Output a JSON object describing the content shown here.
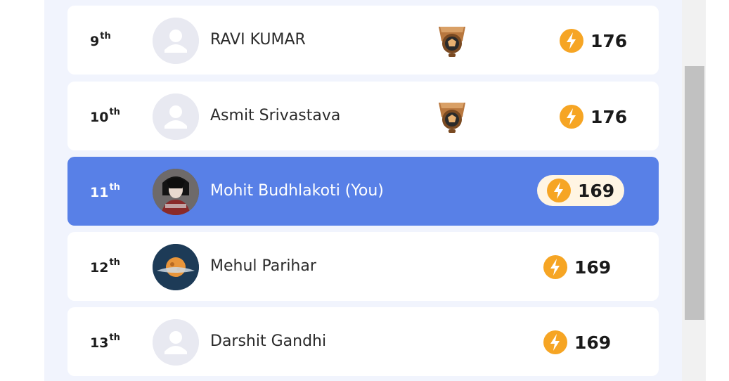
{
  "leaderboard": {
    "rows": [
      {
        "rank_num": "9",
        "rank_suffix": "th",
        "name": "RAVI KUMAR",
        "points": "176",
        "avatar": "default-avatar-icon",
        "trophy": "bronze-trophy-icon",
        "highlight": false
      },
      {
        "rank_num": "10",
        "rank_suffix": "th",
        "name": "Asmit Srivastava",
        "points": "176",
        "avatar": "default-avatar-icon",
        "trophy": "bronze-trophy-icon",
        "highlight": false
      },
      {
        "rank_num": "11",
        "rank_suffix": "th",
        "name": "Mohit Budhlakoti (You)",
        "points": "169",
        "avatar": "user-photo",
        "trophy": null,
        "highlight": true
      },
      {
        "rank_num": "12",
        "rank_suffix": "th",
        "name": "Mehul Parihar",
        "points": "169",
        "avatar": "user-photo",
        "trophy": null,
        "highlight": false
      },
      {
        "rank_num": "13",
        "rank_suffix": "th",
        "name": "Darshit Gandhi",
        "points": "169",
        "avatar": "default-avatar-icon",
        "trophy": null,
        "highlight": false
      }
    ]
  },
  "colors": {
    "panel_bg": "#f1f4fd",
    "highlight_row": "#5880e7",
    "bolt": "#f6a524",
    "score_pill": "#fff5e3"
  }
}
